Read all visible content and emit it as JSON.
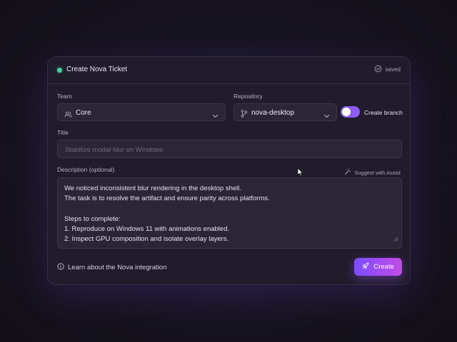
{
  "header": {
    "title": "Create Nova Ticket",
    "status_text": "saved",
    "status_color": "#3ed39a"
  },
  "team": {
    "label": "Team",
    "value": "Core",
    "icon": "users-icon"
  },
  "repository": {
    "label": "Repository",
    "value": "nova-desktop",
    "icon": "git-branch-icon"
  },
  "create_branch": {
    "label": "Create branch",
    "enabled": true
  },
  "title_field": {
    "label": "Title",
    "placeholder": "Stabilize modal blur on Windows",
    "value": ""
  },
  "description": {
    "label": "Description (optional)",
    "assist_label": "Suggest with Assist",
    "value": "We noticed inconsistent blur rendering in the desktop shell.\nThe task is to resolve the artifact and ensure parity across platforms.\n\nSteps to complete:\n1. Reproduce on Windows 11 with animations enabled.\n2. Inspect GPU composition and isolate overlay layers."
  },
  "footer": {
    "learn_link": "Learn about the Nova integration",
    "create_button": "Create"
  },
  "colors": {
    "accent": "#8b5cf6",
    "button_gradient_start": "#7c4dff",
    "button_gradient_end": "#c24ce6"
  }
}
